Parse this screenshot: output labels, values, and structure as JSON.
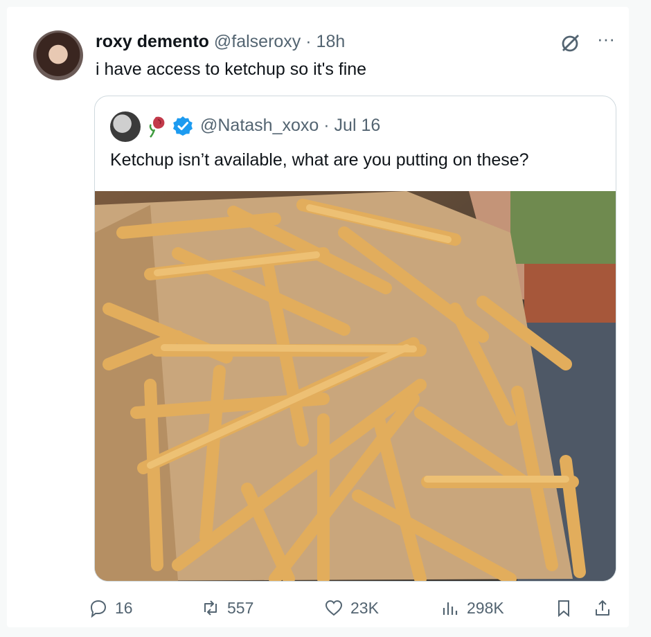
{
  "author": {
    "display_name": "roxy demento",
    "handle": "@falseroxy",
    "separator": "·",
    "time": "18h",
    "text": "i have access to ketchup so it's fine"
  },
  "quoted": {
    "handle": "@Natash_xoxo",
    "separator": "·",
    "date": "Jul 16",
    "text": "Ketchup isn’t available, what are you putting on these?"
  },
  "actions": {
    "replies": "16",
    "reposts": "557",
    "likes": "23K",
    "views": "298K"
  },
  "colors": {
    "verified": "#1d9bf0",
    "muted": "#536471"
  }
}
